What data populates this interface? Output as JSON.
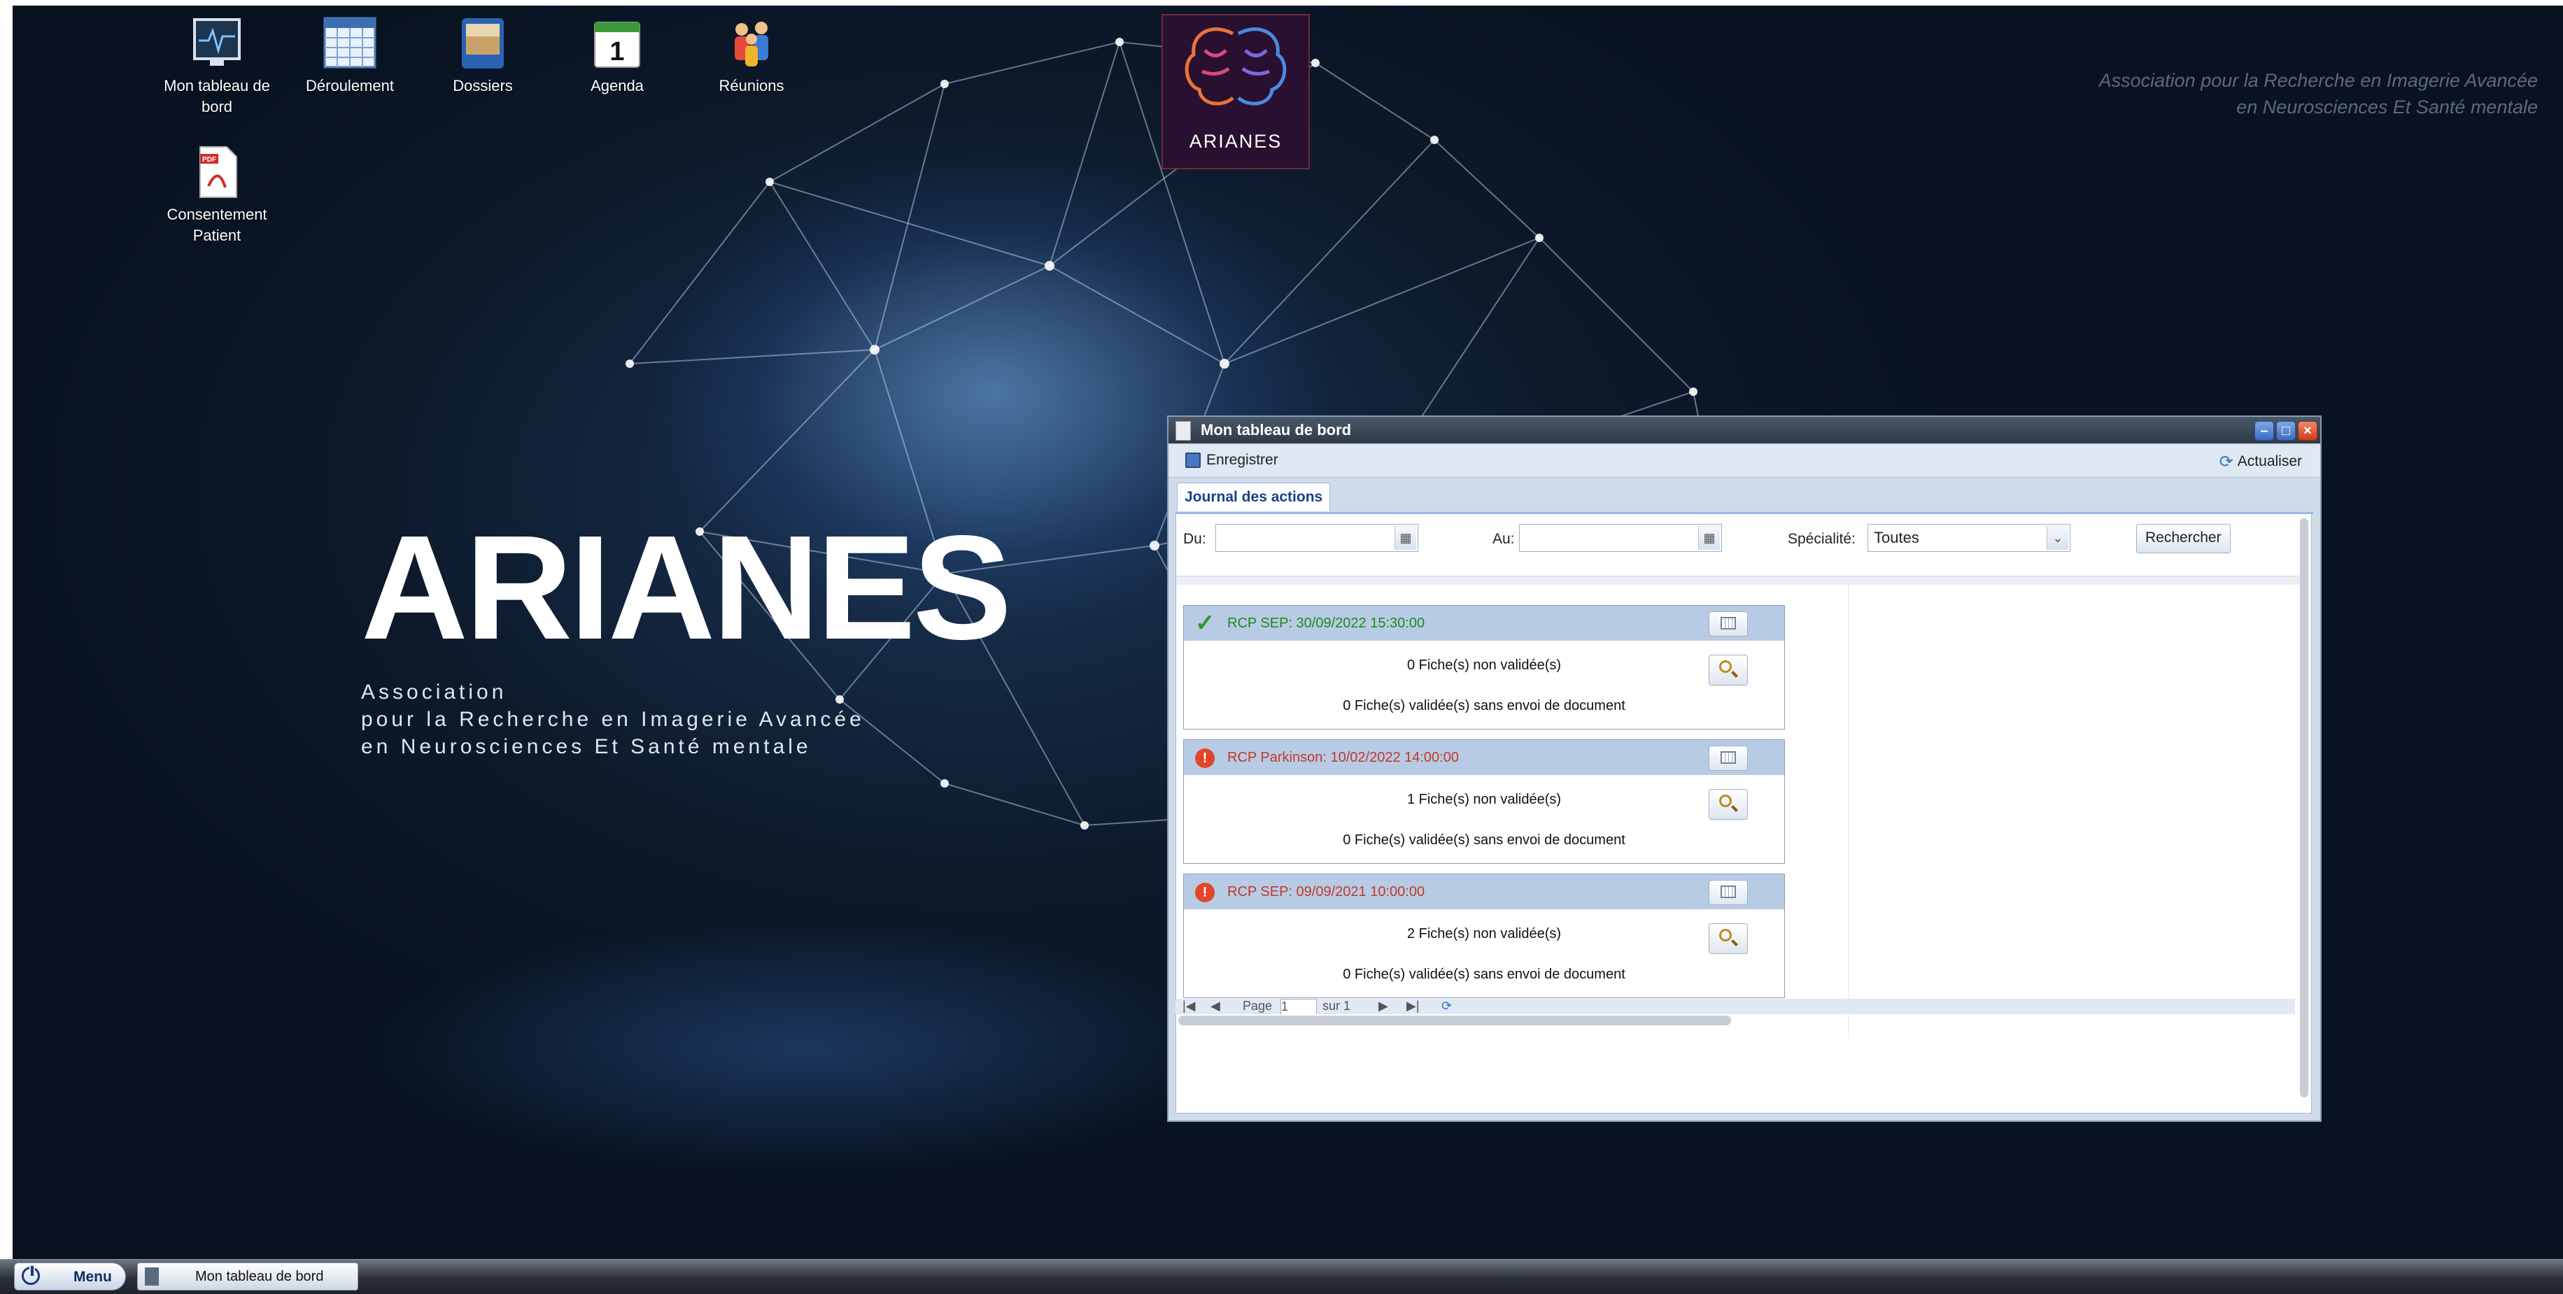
{
  "desktop": {
    "icons": [
      {
        "label": "Mon tableau de bord",
        "icon": "dashboard-icon"
      },
      {
        "label": "Déroulement",
        "icon": "calendar-grid-icon"
      },
      {
        "label": "Dossiers",
        "icon": "folder-icon"
      },
      {
        "label": "Agenda",
        "icon": "agenda-icon"
      },
      {
        "label": "Réunions",
        "icon": "people-icon"
      },
      {
        "label": "Consentement Patient",
        "icon": "pdf-icon"
      }
    ],
    "logo_name": "ARIANES",
    "big_title": "ARIANES",
    "subtitle_lines": [
      "Association",
      "pour la Recherche en Imagerie Avancée",
      "en Neurosciences Et Santé mentale"
    ],
    "top_right_lines": [
      "Association pour la Recherche en Imagerie Avancée",
      "en Neurosciences Et Santé mentale"
    ]
  },
  "window": {
    "title": "Mon tableau de bord",
    "toolbar": {
      "save_label": "Enregistrer",
      "refresh_label": "Actualiser"
    },
    "tab_label": "Journal des actions",
    "filters": {
      "from_label": "Du:",
      "from_value": "",
      "to_label": "Au:",
      "to_value": "",
      "specialty_label": "Spécialité:",
      "specialty_value": "Toutes",
      "search_label": "Rechercher"
    },
    "cards": [
      {
        "status": "ok",
        "title": "RCP SEP: 30/09/2022 15:30:00",
        "line1": "0 Fiche(s) non validée(s)",
        "line2": "0 Fiche(s) validée(s) sans envoi de document"
      },
      {
        "status": "warning",
        "title": "RCP Parkinson: 10/02/2022 14:00:00",
        "line1": "1 Fiche(s) non validée(s)",
        "line2": "0 Fiche(s) validée(s) sans envoi de document"
      },
      {
        "status": "warning",
        "title": "RCP SEP: 09/09/2021 10:00:00",
        "line1": "2 Fiche(s) non validée(s)",
        "line2": "0 Fiche(s) validée(s) sans envoi de document"
      }
    ],
    "pager": {
      "page_label": "Page",
      "page_value": "1",
      "of_label": "sur 1"
    }
  },
  "taskbar": {
    "menu_label": "Menu",
    "task_label": "Mon tableau de bord"
  },
  "colors": {
    "ok": "#1d8a1d",
    "warning": "#c0392b",
    "header_blue": "#b8cbe4"
  }
}
